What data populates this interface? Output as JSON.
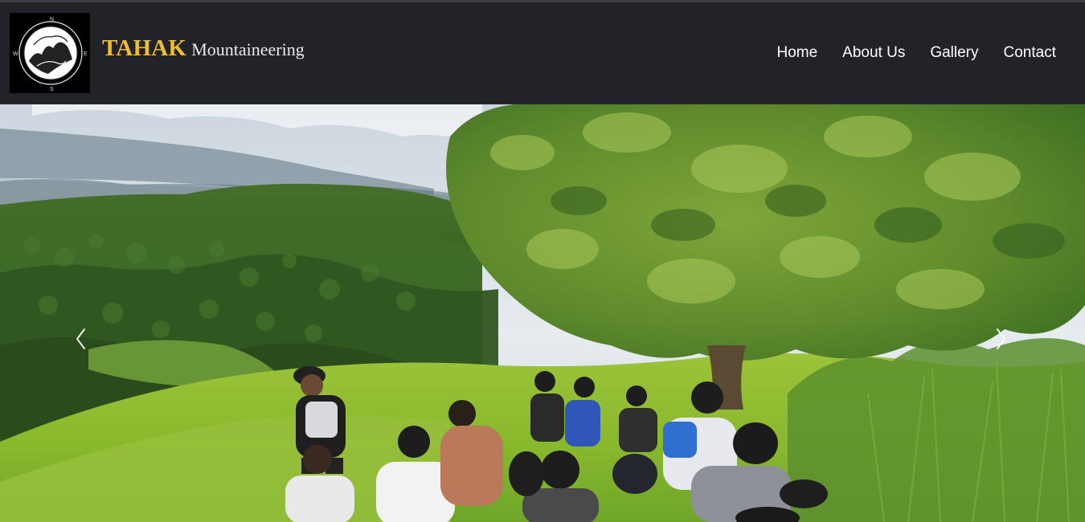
{
  "header": {
    "brand_strong": "TAHAK",
    "brand_rest": "Mountaineering",
    "logo_compass": {
      "north": "N",
      "east": "E",
      "south": "S",
      "west": "W"
    },
    "nav": [
      {
        "label": "Home"
      },
      {
        "label": "About Us"
      },
      {
        "label": "Gallery"
      },
      {
        "label": "Contact"
      }
    ]
  },
  "hero": {
    "image_subject": "hikers-on-hillside-photo",
    "prev_icon": "chevron-left-icon",
    "next_icon": "chevron-right-icon"
  },
  "colors": {
    "navbar_bg": "#212328",
    "brand_accent": "#f0bf2b",
    "nav_text": "#ffffff"
  }
}
